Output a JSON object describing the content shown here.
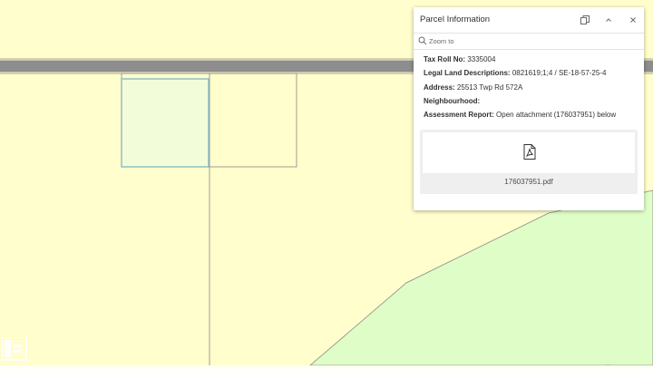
{
  "popup": {
    "title": "Parcel Information",
    "zoom_label": "Zoom to",
    "fields": [
      {
        "label": "Tax Roll No:",
        "value": "3335004"
      },
      {
        "label": "Legal Land Descriptions:",
        "value": "0821619;1;4 / SE-18-57-25-4"
      },
      {
        "label": "Address:",
        "value": "25513 Twp Rd 572A"
      },
      {
        "label": "Neighbourhood:",
        "value": ""
      },
      {
        "label": "Assessment Report:",
        "value": "Open attachment (176037951) below"
      }
    ],
    "attachment": {
      "file_name": "176037951.pdf"
    }
  },
  "map": {
    "colors": {
      "parcel_fill": "#fffecc",
      "selected_fill": "#f3fcd8",
      "selected_outline": "#7fb6c4",
      "green_area": "#dffdc7",
      "road_fill": "#8d8d8d",
      "parcel_line": "#888888"
    }
  },
  "icons": [
    "search-icon",
    "dock-icon",
    "collapse-icon",
    "close-icon",
    "pdf-icon"
  ]
}
